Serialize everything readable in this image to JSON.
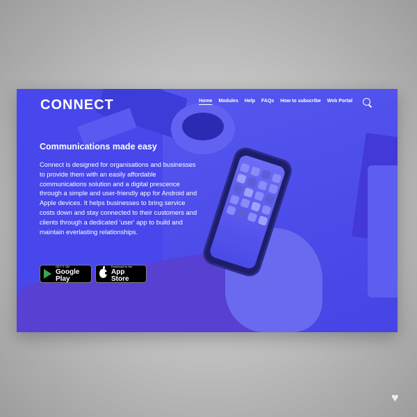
{
  "header": {
    "logo": "CONNECT",
    "nav": [
      "Home",
      "Modules",
      "Help",
      "FAQs",
      "How to subscribe",
      "Web Portal"
    ],
    "active_nav": "Home",
    "search_icon": "search-icon"
  },
  "hero": {
    "title": "Communications made easy",
    "body": "Connect is designed for organisations and businesses to provide them with an easily affordable communications solution and a digital prescence through a simple and user-friendly app for Android and Apple devices. It helps businesses to bring service costs down and stay connected to their customers and clients through a dedicated 'user' app to build and maintain everlasting relationships."
  },
  "badges": {
    "google_play": {
      "small": "GET IT ON",
      "big": "Google Play"
    },
    "app_store": {
      "small": "Download on the",
      "big": "App Store"
    }
  },
  "colors": {
    "overlay": "#4747ec",
    "text": "#ffffff"
  },
  "watermark_icon": "heart-icon"
}
